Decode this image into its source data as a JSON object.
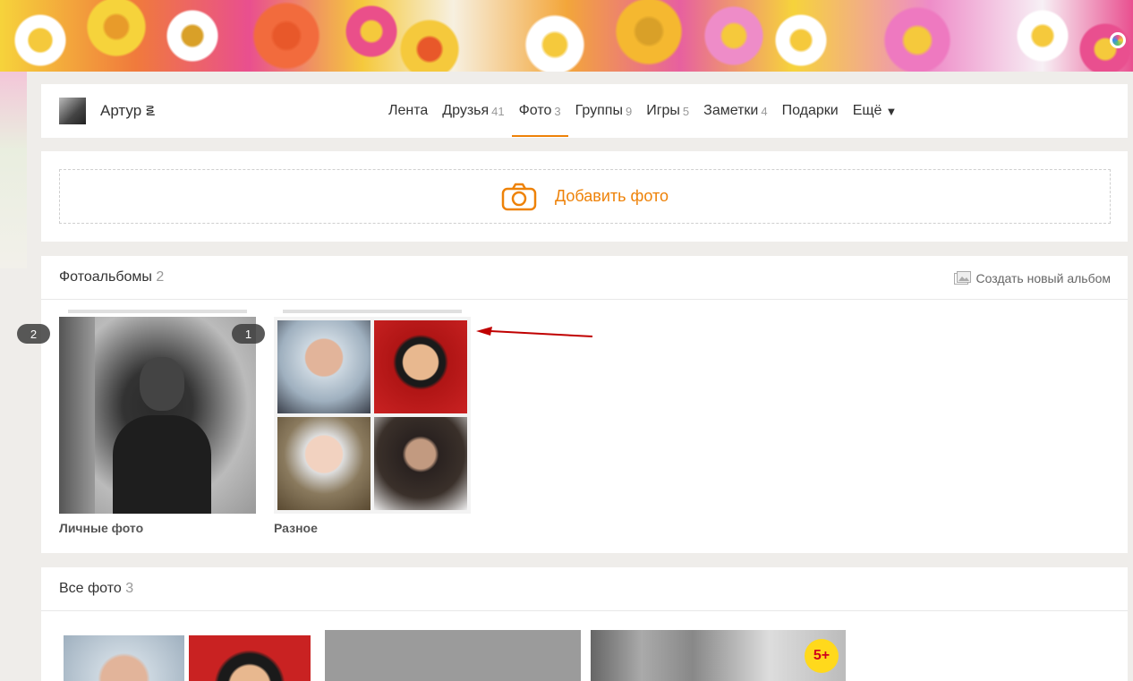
{
  "profile": {
    "name": "Артур ౾"
  },
  "nav": {
    "items": [
      {
        "label": "Лента",
        "count": ""
      },
      {
        "label": "Друзья",
        "count": "41"
      },
      {
        "label": "Фото",
        "count": "3"
      },
      {
        "label": "Группы",
        "count": "9"
      },
      {
        "label": "Игры",
        "count": "5"
      },
      {
        "label": "Заметки",
        "count": "4"
      },
      {
        "label": "Подарки",
        "count": ""
      },
      {
        "label": "Ещё",
        "count": ""
      }
    ],
    "more_icon": "triangle-down"
  },
  "add_photo": {
    "label": "Добавить фото",
    "icon": "camera-icon"
  },
  "albums": {
    "title": "Фотоальбомы",
    "count": "2",
    "create_label": "Создать новый альбом",
    "items": [
      {
        "title": "Личные фото",
        "badge": "2"
      },
      {
        "title": "Разное",
        "badge": "1"
      }
    ]
  },
  "all_photos": {
    "title": "Все фото",
    "count": "3",
    "badge": "5+"
  },
  "colors": {
    "accent": "#ee8208",
    "counter": "#999999",
    "badge_bg": "#ffd91c",
    "badge_text": "#d0021b",
    "arrow": "#c00000"
  }
}
